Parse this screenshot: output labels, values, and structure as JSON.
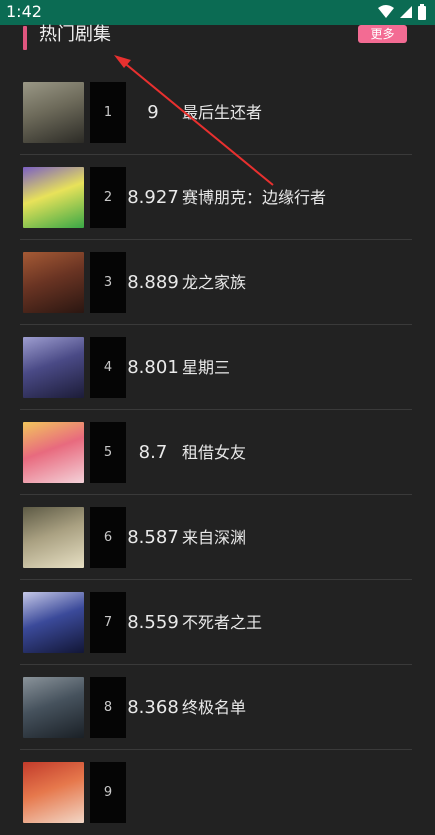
{
  "status_bar": {
    "time": "1:42"
  },
  "section": {
    "title": "热门剧集",
    "more_label": "更多",
    "accent_color": "#e0567f",
    "more_color": "#f36b93"
  },
  "shows": [
    {
      "rank": "1",
      "score": "9",
      "title": "最后生还者",
      "poster_colors": [
        "#2c2b26",
        "#6d6a5a",
        "#9a9886"
      ]
    },
    {
      "rank": "2",
      "score": "8.927",
      "title": "赛博朋克：边缘行者",
      "poster_colors": [
        "#39a846",
        "#e8e25a",
        "#7b5fc4"
      ]
    },
    {
      "rank": "3",
      "score": "8.889",
      "title": "龙之家族",
      "poster_colors": [
        "#2a1611",
        "#6a3423",
        "#a55a35"
      ]
    },
    {
      "rank": "4",
      "score": "8.801",
      "title": "星期三",
      "poster_colors": [
        "#1c1c38",
        "#4a4a86",
        "#9e9ed0"
      ]
    },
    {
      "rank": "5",
      "score": "8.7",
      "title": "租借女友",
      "poster_colors": [
        "#f4d2d9",
        "#e86a7e",
        "#f2c65c"
      ]
    },
    {
      "rank": "6",
      "score": "8.587",
      "title": "来自深渊",
      "poster_colors": [
        "#e7e0c4",
        "#a9a081",
        "#5d5a45"
      ]
    },
    {
      "rank": "7",
      "score": "8.559",
      "title": "不死者之王",
      "poster_colors": [
        "#121636",
        "#3b4a9a",
        "#c6c9e8"
      ]
    },
    {
      "rank": "8",
      "score": "8.368",
      "title": "终极名单",
      "poster_colors": [
        "#1a2026",
        "#46525d",
        "#8a939a"
      ]
    },
    {
      "rank": "9",
      "score": "",
      "title": "",
      "poster_colors": [
        "#f2d7c7",
        "#e6784c",
        "#c23b2b"
      ]
    }
  ],
  "annotation": {
    "arrow_color": "#e8302f"
  }
}
